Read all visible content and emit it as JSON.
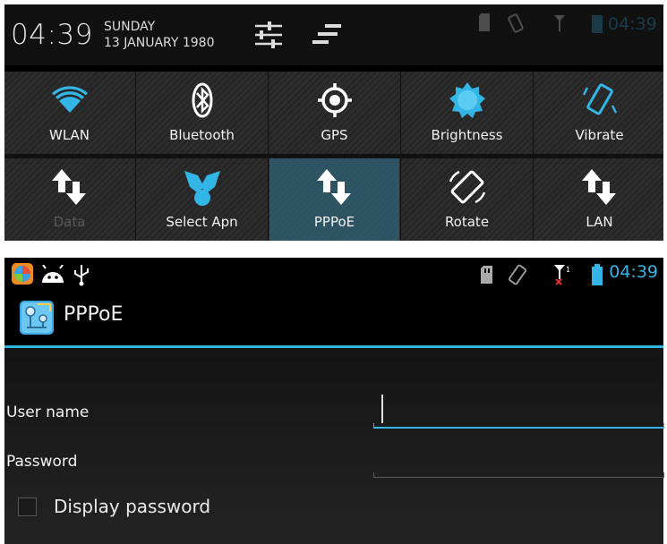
{
  "quick_settings": {
    "time": "04:39",
    "day": "SUNDAY",
    "date": "13 JANUARY 1980",
    "status_time": "04:39",
    "tiles": [
      {
        "label": "WLAN",
        "icon": "wifi-icon",
        "state": "on"
      },
      {
        "label": "Bluetooth",
        "icon": "bluetooth-icon",
        "state": "on"
      },
      {
        "label": "GPS",
        "icon": "gps-icon",
        "state": "on"
      },
      {
        "label": "Brightness",
        "icon": "brightness-icon",
        "state": "on"
      },
      {
        "label": "Vibrate",
        "icon": "vibrate-icon",
        "state": "on"
      },
      {
        "label": "Data",
        "icon": "data-transfer-icon",
        "state": "disabled"
      },
      {
        "label": "Select Apn",
        "icon": "select-apn-icon",
        "state": "on"
      },
      {
        "label": "PPPoE",
        "icon": "pppoe-transfer-icon",
        "state": "active"
      },
      {
        "label": "Rotate",
        "icon": "rotate-icon",
        "state": "on"
      },
      {
        "label": "LAN",
        "icon": "lan-transfer-icon",
        "state": "on"
      }
    ]
  },
  "status_bar": {
    "time": "04:39",
    "left_icons": [
      "app-launcher-icon",
      "android-icon",
      "usb-icon"
    ],
    "right_icons": [
      "sd-card-icon",
      "vibrate-icon",
      "no-signal-icon",
      "battery-icon"
    ]
  },
  "action_bar": {
    "title": "PPPoE",
    "icon": "pppoe-app-icon"
  },
  "form": {
    "username_label": "User name",
    "username_value": "",
    "password_label": "Password",
    "password_value": "",
    "show_password_label": "Display password",
    "show_password_checked": false
  },
  "colors": {
    "accent": "#33b5e5",
    "active_tile": "#337794"
  }
}
